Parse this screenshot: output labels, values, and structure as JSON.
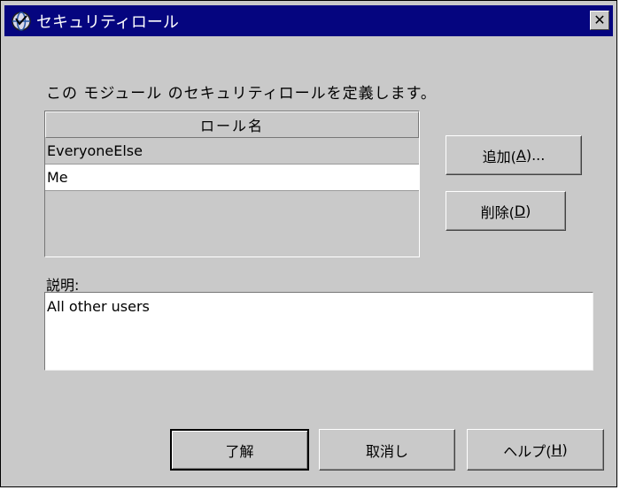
{
  "window": {
    "title": "セキュリティロール",
    "close_label": "✕"
  },
  "dialog": {
    "description": "この モジュール のセキュリティロールを定義します。",
    "roles": {
      "column_header": "ロール名",
      "rows": [
        "EveryoneElse",
        "Me"
      ],
      "selected_index": 1
    },
    "buttons": {
      "add": {
        "label": "追加(",
        "accel": "A",
        "suffix": ")..."
      },
      "delete": {
        "label": "削除(",
        "accel": "D",
        "suffix": ")"
      }
    },
    "description_label": "説明:",
    "description_text": "All other users"
  },
  "footer": {
    "ok_label": "了解",
    "cancel_label": "取消し",
    "help": {
      "label": "ヘルプ(",
      "accel": "H",
      "suffix": ")"
    }
  }
}
